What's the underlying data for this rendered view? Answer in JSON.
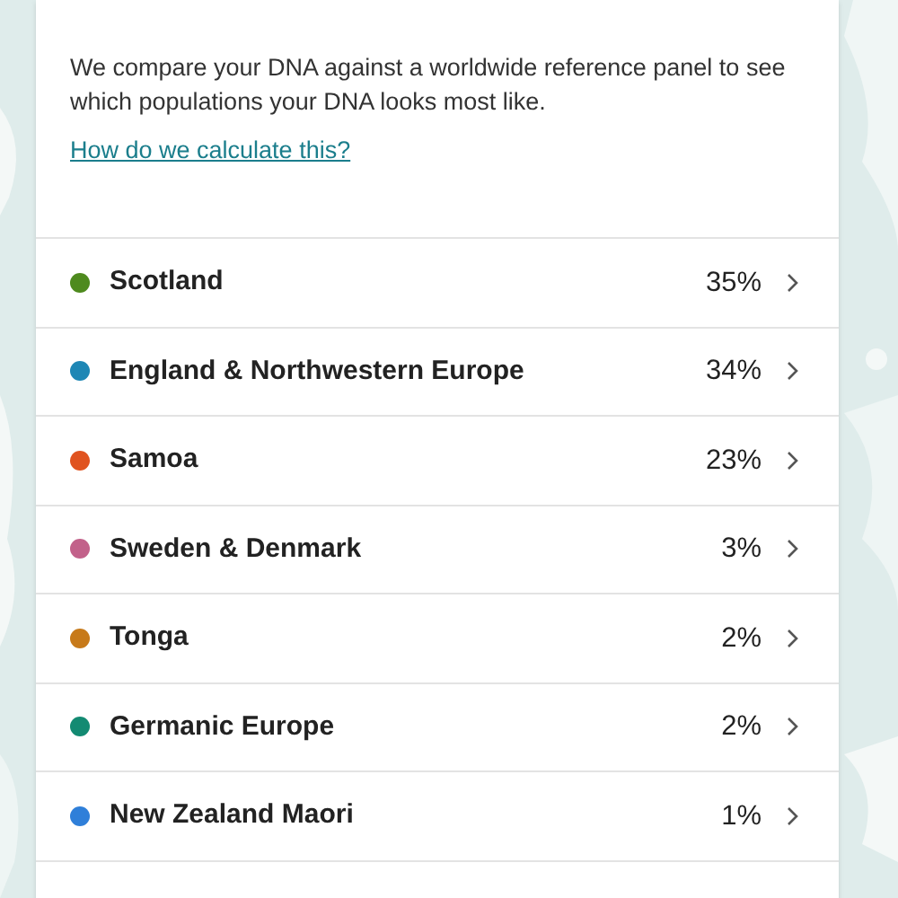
{
  "card": {
    "description": "We compare your DNA against a worldwide reference panel to see which populations your DNA looks most like.",
    "link": "How do we calculate this?"
  },
  "regions": [
    {
      "name": "Scotland",
      "percent": "35%",
      "color": "#4e8a1e"
    },
    {
      "name": "England & Northwestern Europe",
      "percent": "34%",
      "color": "#1e87b5"
    },
    {
      "name": "Samoa",
      "percent": "23%",
      "color": "#e0531f"
    },
    {
      "name": "Sweden & Denmark",
      "percent": "3%",
      "color": "#c2618a"
    },
    {
      "name": "Tonga",
      "percent": "2%",
      "color": "#c77a1a"
    },
    {
      "name": "Germanic Europe",
      "percent": "2%",
      "color": "#138a72"
    },
    {
      "name": "New Zealand Maori",
      "percent": "1%",
      "color": "#2f7fd9"
    }
  ]
}
